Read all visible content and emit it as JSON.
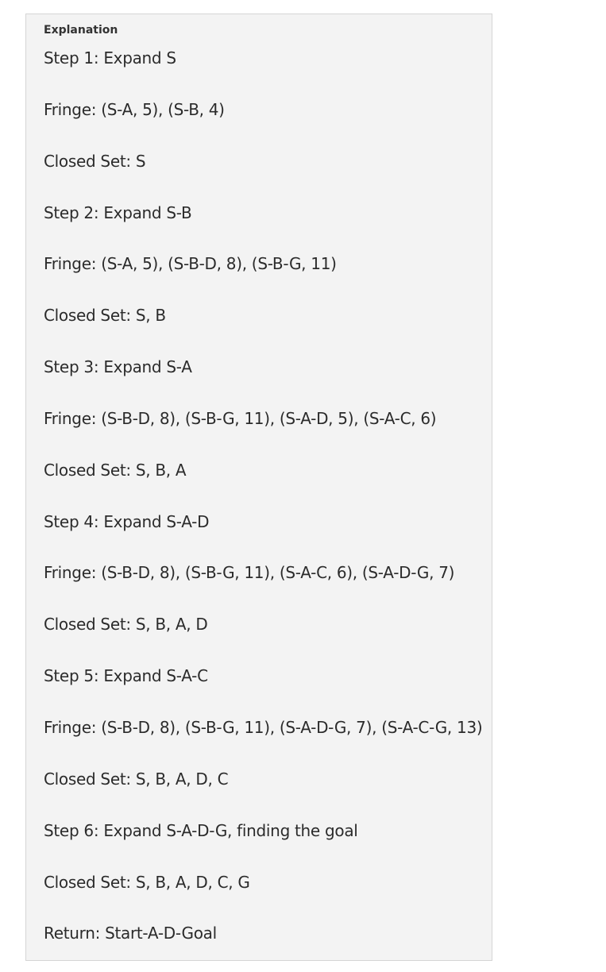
{
  "explanation": {
    "title": "Explanation",
    "lines": [
      "Step 1: Expand S",
      "Fringe: (S-A, 5), (S-B, 4)",
      "Closed Set: S",
      "Step 2: Expand S-B",
      "Fringe: (S-A, 5), (S-B-D, 8), (S-B-G, 11)",
      "Closed Set: S, B",
      "Step 3: Expand S-A",
      "Fringe: (S-B-D, 8), (S-B-G, 11), (S-A-D, 5), (S-A-C, 6)",
      "Closed Set: S, B, A",
      "Step 4: Expand S-A-D",
      "Fringe: (S-B-D, 8), (S-B-G, 11), (S-A-C, 6), (S-A-D-G, 7)",
      "Closed Set: S, B, A, D",
      "Step 5: Expand S-A-C",
      "Fringe: (S-B-D, 8), (S-B-G, 11), (S-A-D-G, 7), (S-A-C-G, 13)",
      "Closed Set: S, B, A, D, C",
      "Step 6: Expand S-A-D-G, finding the goal",
      "Closed Set: S, B, A, D, C, G",
      "Return: Start-A-D-Goal"
    ]
  }
}
